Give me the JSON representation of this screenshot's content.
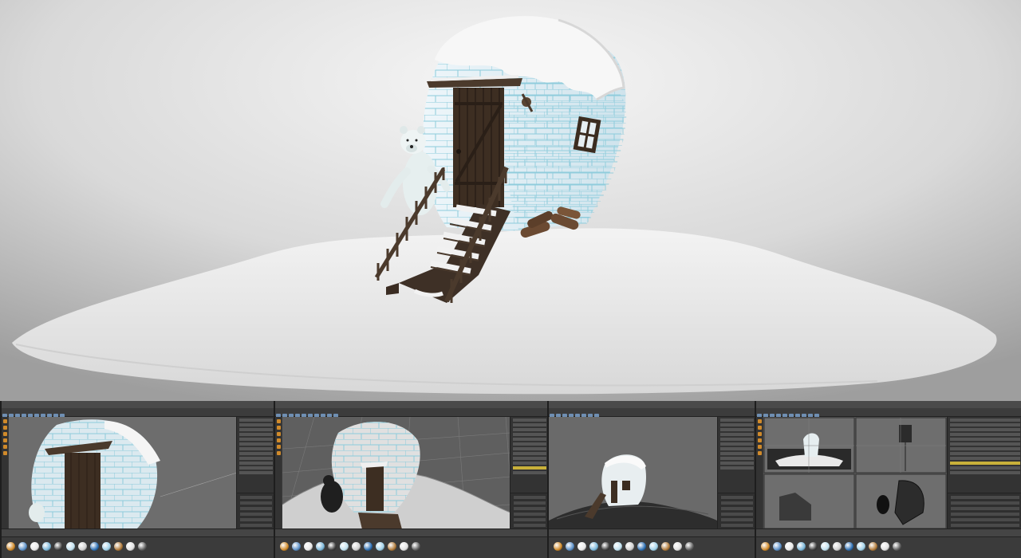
{
  "scene": {
    "description_free": true,
    "objects": [
      "snow-mound",
      "hut",
      "door",
      "stairs",
      "polar-bear",
      "window",
      "logs",
      "snow-cap"
    ]
  },
  "panels": [
    {
      "name": "panel-1",
      "view": "perspective-closeup"
    },
    {
      "name": "panel-2",
      "view": "wireframe"
    },
    {
      "name": "panel-3",
      "view": "perspective-wide"
    },
    {
      "name": "panel-4",
      "view": "four-view"
    }
  ],
  "colors": {
    "background_top": "#f4f4f4",
    "background_bottom": "#9c9c9c",
    "snow": "#ededed",
    "wood": "#4b3a2c",
    "tile_line": "#7fc6d6",
    "ui_dark": "#3a3a3a",
    "ui_accent": "#d08a2a",
    "ui_highlight": "#c9b13a"
  },
  "material_colors": [
    "#d08a2a",
    "#5b8fc7",
    "#e8e8e8",
    "#7ab6d9",
    "#3f3f3f",
    "#bfe0ef",
    "#cfcfcf",
    "#2d6fb3",
    "#9fd0e8",
    "#b07a3a",
    "#e0e0e0",
    "#5e5e5e"
  ]
}
